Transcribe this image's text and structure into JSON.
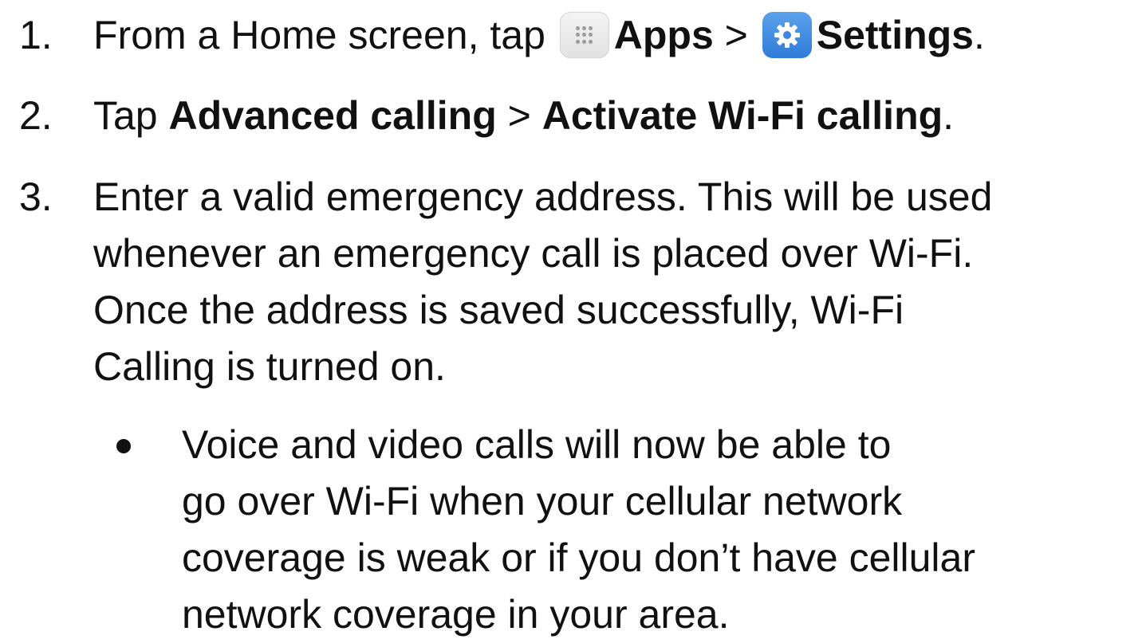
{
  "steps": [
    {
      "number": "1.",
      "t1": "From a Home screen, tap ",
      "apps": "Apps",
      "sep": " > ",
      "settings": "Settings",
      "end": "."
    },
    {
      "number": "2.",
      "t1": "Tap ",
      "b1": "Advanced calling",
      "sep": " > ",
      "b2": "Activate Wi-Fi calling",
      "end": "."
    },
    {
      "number": "3.",
      "lines": [
        "Enter a valid emergency address. This will be used",
        "whenever an emergency call is placed over Wi-Fi.",
        "Once the address is saved successfully, Wi-Fi",
        "Calling is turned on."
      ]
    }
  ],
  "bullet": {
    "lines": [
      "Voice and video calls will now be able to",
      "go over Wi-Fi when your cellular network",
      "coverage is weak or if you don’t have cellular",
      "network coverage in your area."
    ]
  },
  "icons": {
    "apps": "apps-grid-icon",
    "settings": "settings-gear-icon"
  },
  "colors": {
    "text": "#111111",
    "settings_icon": "#3b86de",
    "apps_icon": "#ebebeb"
  }
}
